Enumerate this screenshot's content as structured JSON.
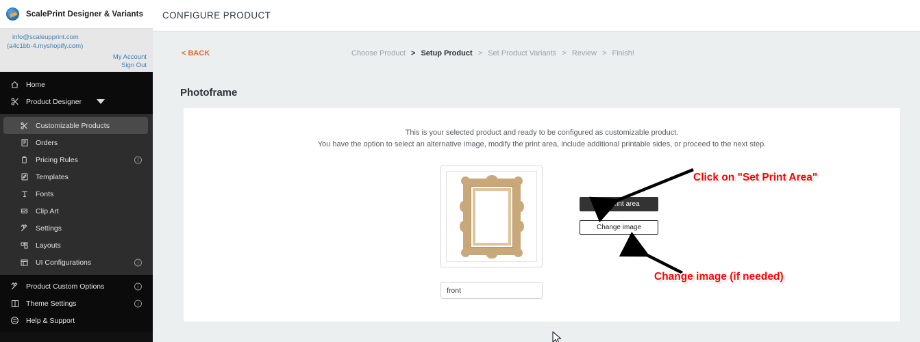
{
  "sidebar": {
    "brand": {
      "title": "ScalePrint Designer & Variants",
      "logo_icon": "app-logo-icon"
    },
    "account": {
      "email": "info@scaleupprint.com",
      "shop": "(a4c1bb-4.myshopify.com)",
      "my_account": "My Account",
      "sign_out": "Sign Out"
    },
    "top_items": [
      {
        "label": "Home",
        "icon": "home-icon"
      },
      {
        "label": "Product Designer",
        "icon": "designer-icon",
        "caret": true
      }
    ],
    "mid_items": [
      {
        "label": "Customizable Products",
        "icon": "designer-icon",
        "active": true,
        "info": false
      },
      {
        "label": "Orders",
        "icon": "orders-icon",
        "info": false
      },
      {
        "label": "Pricing Rules",
        "icon": "pricing-icon",
        "info": true
      },
      {
        "label": "Templates",
        "icon": "templates-icon",
        "info": false
      },
      {
        "label": "Fonts",
        "icon": "fonts-icon",
        "info": false
      },
      {
        "label": "Clip Art",
        "icon": "clipart-icon",
        "info": false
      },
      {
        "label": "Settings",
        "icon": "settings-icon",
        "info": false
      },
      {
        "label": "Layouts",
        "icon": "layouts-icon",
        "info": false
      },
      {
        "label": "UI Configurations",
        "icon": "ui-config-icon",
        "info": true
      }
    ],
    "bottom_items": [
      {
        "label": "Product Custom Options",
        "icon": "settings-icon",
        "info": true
      },
      {
        "label": "Theme Settings",
        "icon": "theme-icon",
        "info": true
      },
      {
        "label": "Help & Support",
        "icon": "help-icon",
        "info": false
      }
    ]
  },
  "header": {
    "title": "CONFIGURE PRODUCT"
  },
  "nav": {
    "back_label": "< BACK",
    "steps": [
      {
        "label": "Choose Product",
        "current": false
      },
      {
        "label": "Setup Product",
        "current": true
      },
      {
        "label": "Set Product Variants",
        "current": false
      },
      {
        "label": "Review",
        "current": false
      },
      {
        "label": "Finish!",
        "current": false
      }
    ],
    "separator": ">"
  },
  "page": {
    "title": "Photoframe",
    "intro_line1": "This is your selected product and ready to be configured as customizable product.",
    "intro_line2": "You have the option to select an alternative image, modify the print area, include additional printable sides, or proceed to the next step."
  },
  "product": {
    "thumbnail_alt": "photoframe-thumbnail",
    "side_name_value": "front",
    "side_name_placeholder": "front"
  },
  "buttons": {
    "set_print_area": "Set print area",
    "change_image": "Change image"
  },
  "annotations": [
    {
      "text": "Click on \"Set Print Area\"",
      "color": "#ff0000"
    },
    {
      "text": "Change image (if needed)",
      "color": "#ff0000"
    }
  ]
}
